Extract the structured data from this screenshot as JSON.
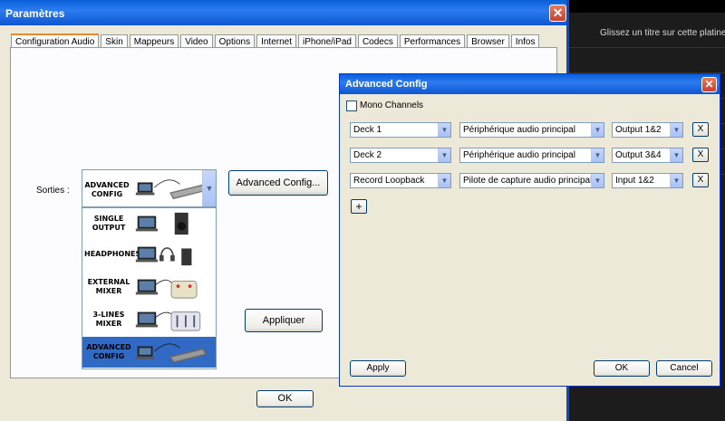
{
  "background_app": {
    "hint_text": "Glissez un titre sur cette platine p"
  },
  "parametres": {
    "title": "Paramètres",
    "tabs": [
      "Configuration Audio",
      "Skin",
      "Mappeurs",
      "Video",
      "Options",
      "Internet",
      "iPhone/iPad",
      "Codecs",
      "Performances",
      "Browser",
      "Infos"
    ],
    "sorties_label": "Sorties :",
    "selected_output": {
      "line1": "ADVANCED",
      "line2": "CONFIG"
    },
    "output_options": [
      {
        "line1": "SINGLE",
        "line2": "OUTPUT"
      },
      {
        "line1": "HEADPHONES",
        "line2": ""
      },
      {
        "line1": "EXTERNAL",
        "line2": "MIXER"
      },
      {
        "line1": "3-LINES",
        "line2": "MIXER"
      },
      {
        "line1": "ADVANCED",
        "line2": "CONFIG"
      }
    ],
    "advanced_config_button": "Advanced Config...",
    "appliquer_button": "Appliquer",
    "ok_button": "OK"
  },
  "advanced_config": {
    "title": "Advanced Config",
    "mono_channels_label": "Mono Channels",
    "mono_channels_checked": false,
    "rows": [
      {
        "deck": "Deck 1",
        "device": "Périphérique audio principal",
        "output": "Output 1&2",
        "remove": "X"
      },
      {
        "deck": "Deck 2",
        "device": "Périphérique audio principal",
        "output": "Output 3&4",
        "remove": "X"
      },
      {
        "deck": "Record Loopback",
        "device": "Pilote de capture audio principal",
        "output": "Input 1&2",
        "remove": "X"
      }
    ],
    "add_button": "+",
    "apply_button": "Apply",
    "ok_button": "OK",
    "cancel_button": "Cancel"
  },
  "colors": {
    "titlebar_blue": "#0a5fd8",
    "selection_blue": "#316ac5",
    "dialog_face": "#ece9d8"
  }
}
